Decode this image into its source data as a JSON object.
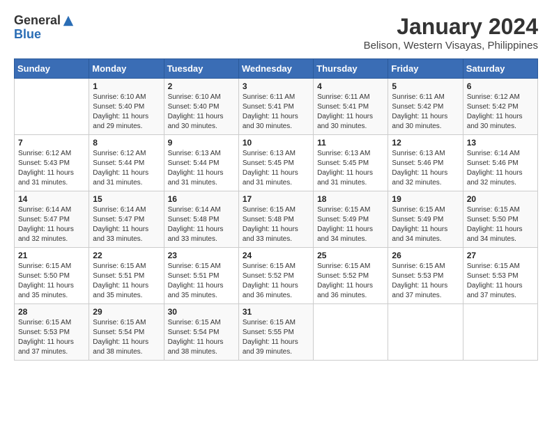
{
  "header": {
    "logo_general": "General",
    "logo_blue": "Blue",
    "month_year": "January 2024",
    "location": "Belison, Western Visayas, Philippines"
  },
  "weekdays": [
    "Sunday",
    "Monday",
    "Tuesday",
    "Wednesday",
    "Thursday",
    "Friday",
    "Saturday"
  ],
  "weeks": [
    [
      {
        "day": "",
        "sunrise": "",
        "sunset": "",
        "daylight": ""
      },
      {
        "day": "1",
        "sunrise": "Sunrise: 6:10 AM",
        "sunset": "Sunset: 5:40 PM",
        "daylight": "Daylight: 11 hours and 29 minutes."
      },
      {
        "day": "2",
        "sunrise": "Sunrise: 6:10 AM",
        "sunset": "Sunset: 5:40 PM",
        "daylight": "Daylight: 11 hours and 30 minutes."
      },
      {
        "day": "3",
        "sunrise": "Sunrise: 6:11 AM",
        "sunset": "Sunset: 5:41 PM",
        "daylight": "Daylight: 11 hours and 30 minutes."
      },
      {
        "day": "4",
        "sunrise": "Sunrise: 6:11 AM",
        "sunset": "Sunset: 5:41 PM",
        "daylight": "Daylight: 11 hours and 30 minutes."
      },
      {
        "day": "5",
        "sunrise": "Sunrise: 6:11 AM",
        "sunset": "Sunset: 5:42 PM",
        "daylight": "Daylight: 11 hours and 30 minutes."
      },
      {
        "day": "6",
        "sunrise": "Sunrise: 6:12 AM",
        "sunset": "Sunset: 5:42 PM",
        "daylight": "Daylight: 11 hours and 30 minutes."
      }
    ],
    [
      {
        "day": "7",
        "sunrise": "Sunrise: 6:12 AM",
        "sunset": "Sunset: 5:43 PM",
        "daylight": "Daylight: 11 hours and 31 minutes."
      },
      {
        "day": "8",
        "sunrise": "Sunrise: 6:12 AM",
        "sunset": "Sunset: 5:44 PM",
        "daylight": "Daylight: 11 hours and 31 minutes."
      },
      {
        "day": "9",
        "sunrise": "Sunrise: 6:13 AM",
        "sunset": "Sunset: 5:44 PM",
        "daylight": "Daylight: 11 hours and 31 minutes."
      },
      {
        "day": "10",
        "sunrise": "Sunrise: 6:13 AM",
        "sunset": "Sunset: 5:45 PM",
        "daylight": "Daylight: 11 hours and 31 minutes."
      },
      {
        "day": "11",
        "sunrise": "Sunrise: 6:13 AM",
        "sunset": "Sunset: 5:45 PM",
        "daylight": "Daylight: 11 hours and 31 minutes."
      },
      {
        "day": "12",
        "sunrise": "Sunrise: 6:13 AM",
        "sunset": "Sunset: 5:46 PM",
        "daylight": "Daylight: 11 hours and 32 minutes."
      },
      {
        "day": "13",
        "sunrise": "Sunrise: 6:14 AM",
        "sunset": "Sunset: 5:46 PM",
        "daylight": "Daylight: 11 hours and 32 minutes."
      }
    ],
    [
      {
        "day": "14",
        "sunrise": "Sunrise: 6:14 AM",
        "sunset": "Sunset: 5:47 PM",
        "daylight": "Daylight: 11 hours and 32 minutes."
      },
      {
        "day": "15",
        "sunrise": "Sunrise: 6:14 AM",
        "sunset": "Sunset: 5:47 PM",
        "daylight": "Daylight: 11 hours and 33 minutes."
      },
      {
        "day": "16",
        "sunrise": "Sunrise: 6:14 AM",
        "sunset": "Sunset: 5:48 PM",
        "daylight": "Daylight: 11 hours and 33 minutes."
      },
      {
        "day": "17",
        "sunrise": "Sunrise: 6:15 AM",
        "sunset": "Sunset: 5:48 PM",
        "daylight": "Daylight: 11 hours and 33 minutes."
      },
      {
        "day": "18",
        "sunrise": "Sunrise: 6:15 AM",
        "sunset": "Sunset: 5:49 PM",
        "daylight": "Daylight: 11 hours and 34 minutes."
      },
      {
        "day": "19",
        "sunrise": "Sunrise: 6:15 AM",
        "sunset": "Sunset: 5:49 PM",
        "daylight": "Daylight: 11 hours and 34 minutes."
      },
      {
        "day": "20",
        "sunrise": "Sunrise: 6:15 AM",
        "sunset": "Sunset: 5:50 PM",
        "daylight": "Daylight: 11 hours and 34 minutes."
      }
    ],
    [
      {
        "day": "21",
        "sunrise": "Sunrise: 6:15 AM",
        "sunset": "Sunset: 5:50 PM",
        "daylight": "Daylight: 11 hours and 35 minutes."
      },
      {
        "day": "22",
        "sunrise": "Sunrise: 6:15 AM",
        "sunset": "Sunset: 5:51 PM",
        "daylight": "Daylight: 11 hours and 35 minutes."
      },
      {
        "day": "23",
        "sunrise": "Sunrise: 6:15 AM",
        "sunset": "Sunset: 5:51 PM",
        "daylight": "Daylight: 11 hours and 35 minutes."
      },
      {
        "day": "24",
        "sunrise": "Sunrise: 6:15 AM",
        "sunset": "Sunset: 5:52 PM",
        "daylight": "Daylight: 11 hours and 36 minutes."
      },
      {
        "day": "25",
        "sunrise": "Sunrise: 6:15 AM",
        "sunset": "Sunset: 5:52 PM",
        "daylight": "Daylight: 11 hours and 36 minutes."
      },
      {
        "day": "26",
        "sunrise": "Sunrise: 6:15 AM",
        "sunset": "Sunset: 5:53 PM",
        "daylight": "Daylight: 11 hours and 37 minutes."
      },
      {
        "day": "27",
        "sunrise": "Sunrise: 6:15 AM",
        "sunset": "Sunset: 5:53 PM",
        "daylight": "Daylight: 11 hours and 37 minutes."
      }
    ],
    [
      {
        "day": "28",
        "sunrise": "Sunrise: 6:15 AM",
        "sunset": "Sunset: 5:53 PM",
        "daylight": "Daylight: 11 hours and 37 minutes."
      },
      {
        "day": "29",
        "sunrise": "Sunrise: 6:15 AM",
        "sunset": "Sunset: 5:54 PM",
        "daylight": "Daylight: 11 hours and 38 minutes."
      },
      {
        "day": "30",
        "sunrise": "Sunrise: 6:15 AM",
        "sunset": "Sunset: 5:54 PM",
        "daylight": "Daylight: 11 hours and 38 minutes."
      },
      {
        "day": "31",
        "sunrise": "Sunrise: 6:15 AM",
        "sunset": "Sunset: 5:55 PM",
        "daylight": "Daylight: 11 hours and 39 minutes."
      },
      {
        "day": "",
        "sunrise": "",
        "sunset": "",
        "daylight": ""
      },
      {
        "day": "",
        "sunrise": "",
        "sunset": "",
        "daylight": ""
      },
      {
        "day": "",
        "sunrise": "",
        "sunset": "",
        "daylight": ""
      }
    ]
  ]
}
